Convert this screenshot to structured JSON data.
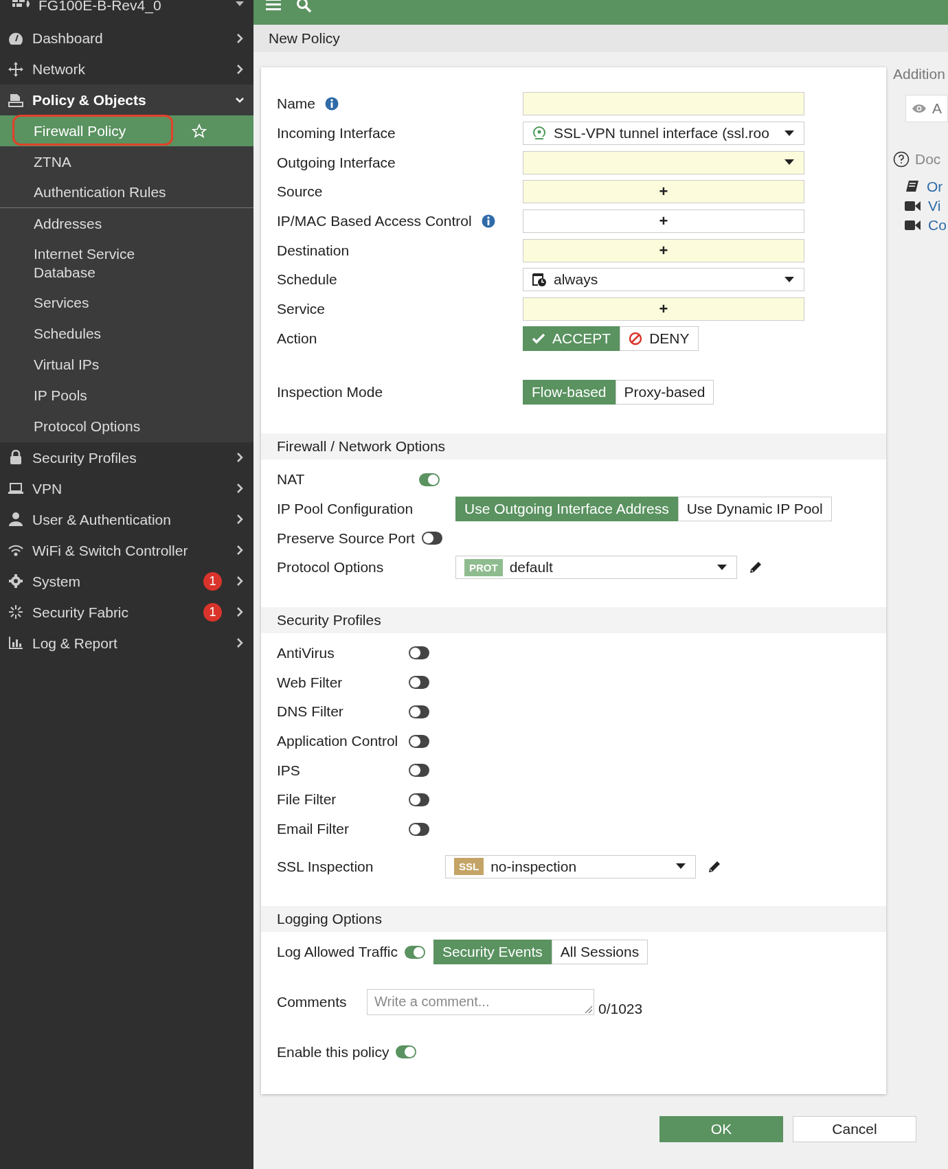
{
  "sidebar": {
    "device": "FG100E-B-Rev4_0",
    "items": [
      {
        "label": "Dashboard",
        "expanded": false
      },
      {
        "label": "Network",
        "expanded": false
      },
      {
        "label": "Policy & Objects",
        "expanded": true,
        "children": [
          {
            "label": "Firewall Policy",
            "selected": true,
            "circled": true
          },
          {
            "label": "ZTNA",
            "selected": false,
            "circled": false
          },
          {
            "label": "Authentication Rules",
            "selected": false,
            "circled": false
          },
          {
            "label": "Addresses",
            "selected": false,
            "circled": false
          },
          {
            "label": "Internet Service Database",
            "selected": false,
            "circled": false
          },
          {
            "label": "Services",
            "selected": false,
            "circled": false
          },
          {
            "label": "Schedules",
            "selected": false,
            "circled": false
          },
          {
            "label": "Virtual IPs",
            "selected": false,
            "circled": false
          },
          {
            "label": "IP Pools",
            "selected": false,
            "circled": false
          },
          {
            "label": "Protocol Options",
            "selected": false,
            "circled": false
          }
        ]
      },
      {
        "label": "Security Profiles",
        "expanded": false
      },
      {
        "label": "VPN",
        "expanded": false
      },
      {
        "label": "User & Authentication",
        "expanded": false
      },
      {
        "label": "WiFi & Switch Controller",
        "expanded": false
      },
      {
        "label": "System",
        "expanded": false,
        "badge": "1"
      },
      {
        "label": "Security Fabric",
        "expanded": false,
        "badge": "1"
      },
      {
        "label": "Log & Report",
        "expanded": false
      }
    ]
  },
  "breadcrumb": "New Policy",
  "sections": [
    {
      "rows": [
        {
          "kind": "text",
          "label": "Name",
          "info": true,
          "required": true
        },
        {
          "kind": "select",
          "label": "Incoming Interface",
          "info": false,
          "required": false,
          "value": "SSL-VPN tunnel interface (ssl.roo"
        },
        {
          "kind": "select",
          "label": "Outgoing Interface",
          "info": false,
          "required": true
        },
        {
          "kind": "add",
          "label": "Source",
          "info": false,
          "required": true,
          "value": "+"
        },
        {
          "kind": "add",
          "label": "IP/MAC Based Access Control",
          "info": true,
          "required": false,
          "value": "+"
        },
        {
          "kind": "add",
          "label": "Destination",
          "info": false,
          "required": true,
          "value": "+"
        },
        {
          "kind": "select",
          "label": "Schedule",
          "info": false,
          "required": false,
          "value": "always"
        },
        {
          "kind": "add",
          "label": "Service",
          "info": false,
          "required": true,
          "value": "+"
        },
        {
          "kind": "action",
          "label": "Action",
          "options": [
            {
              "label": "ACCEPT",
              "selected": true
            },
            {
              "label": "DENY",
              "selected": false
            }
          ]
        },
        {
          "kind": "segmented",
          "label": "Inspection Mode",
          "options": [
            {
              "label": "Flow-based",
              "selected": true
            },
            {
              "label": "Proxy-based",
              "selected": false
            }
          ]
        }
      ]
    },
    {
      "title": "Firewall / Network Options",
      "rows": [
        {
          "kind": "toggle",
          "label": "NAT",
          "on": true
        },
        {
          "kind": "segmented",
          "label": "IP Pool Configuration",
          "options": [
            {
              "label": "Use Outgoing Interface Address",
              "selected": true
            },
            {
              "label": "Use Dynamic IP Pool",
              "selected": false
            }
          ]
        },
        {
          "kind": "toggle",
          "label": "Preserve Source Port",
          "on": false
        },
        {
          "kind": "tagselect",
          "label": "Protocol Options",
          "tag": "PROT",
          "color": "#8fbc8f",
          "value": "default"
        }
      ]
    },
    {
      "title": "Security Profiles",
      "rows": [
        {
          "kind": "toggle",
          "label": "AntiVirus",
          "on": false
        },
        {
          "kind": "toggle",
          "label": "Web Filter",
          "on": false
        },
        {
          "kind": "toggle",
          "label": "DNS Filter",
          "on": false
        },
        {
          "kind": "toggle",
          "label": "Application Control",
          "on": false
        },
        {
          "kind": "toggle",
          "label": "IPS",
          "on": false
        },
        {
          "kind": "toggle",
          "label": "File Filter",
          "on": false
        },
        {
          "kind": "toggle",
          "label": "Email Filter",
          "on": false
        },
        {
          "kind": "tagselect",
          "label": "SSL Inspection",
          "tag": "SSL",
          "color": "#c4a466",
          "value": "no-inspection"
        }
      ]
    },
    {
      "title": "Logging Options",
      "rows": [
        {
          "kind": "toggle-segmented",
          "label": "Log Allowed Traffic",
          "on": true,
          "options": [
            {
              "label": "Security Events",
              "selected": true
            },
            {
              "label": "All Sessions",
              "selected": false
            }
          ]
        },
        {
          "kind": "comment",
          "label": "Comments",
          "placeholder": "Write a comment...",
          "counter": "0/1023"
        },
        {
          "kind": "toggle",
          "label": "Enable this policy",
          "on": true
        }
      ]
    }
  ],
  "side_panel": {
    "title": "Addition",
    "button": "A",
    "docs_title": "Doc",
    "links": [
      "Or",
      "Vi",
      "Co"
    ]
  },
  "buttons": [
    {
      "label": "OK",
      "primary": true
    },
    {
      "label": "Cancel",
      "primary": false
    }
  ]
}
